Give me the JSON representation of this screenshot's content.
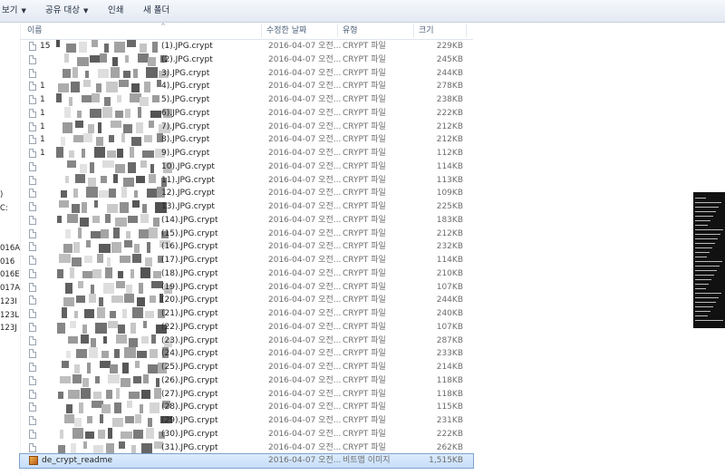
{
  "toolbar": {
    "view_label": "보기",
    "share_label": "공유 대상",
    "print_label": "인쇄",
    "new_folder_label": "새 폴더"
  },
  "nav_pane": {
    "items": [
      ")",
      "C:",
      "016A",
      "016",
      "016E",
      "017A",
      "123I",
      "123L",
      "123J"
    ]
  },
  "columns": {
    "name": "이름",
    "date": "수정한 날짜",
    "type": "유형",
    "size": "크기"
  },
  "files": [
    {
      "prefix": "15",
      "name": "(1).JPG.crypt",
      "date": "2016-04-07 오전...",
      "type": "CRYPT 파일",
      "size": "229KB"
    },
    {
      "prefix": "",
      "name": "(2).JPG.crypt",
      "date": "2016-04-07 오전...",
      "type": "CRYPT 파일",
      "size": "245KB"
    },
    {
      "prefix": "",
      "name": "3).JPG.crypt",
      "date": "2016-04-07 오전...",
      "type": "CRYPT 파일",
      "size": "244KB"
    },
    {
      "prefix": "1",
      "name": "4).JPG.crypt",
      "date": "2016-04-07 오전...",
      "type": "CRYPT 파일",
      "size": "278KB"
    },
    {
      "prefix": "1",
      "name": "5).JPG.crypt",
      "date": "2016-04-07 오전...",
      "type": "CRYPT 파일",
      "size": "238KB"
    },
    {
      "prefix": "1",
      "name": "6).JPG.crypt",
      "date": "2016-04-07 오전...",
      "type": "CRYPT 파일",
      "size": "222KB"
    },
    {
      "prefix": "1",
      "name": "7).JPG.crypt",
      "date": "2016-04-07 오전...",
      "type": "CRYPT 파일",
      "size": "212KB"
    },
    {
      "prefix": "1",
      "name": "8).JPG.crypt",
      "date": "2016-04-07 오전...",
      "type": "CRYPT 파일",
      "size": "212KB"
    },
    {
      "prefix": "1",
      "name": "9).JPG.crypt",
      "date": "2016-04-07 오전...",
      "type": "CRYPT 파일",
      "size": "112KB"
    },
    {
      "prefix": "",
      "name": "10).JPG.crypt",
      "date": "2016-04-07 오전...",
      "type": "CRYPT 파일",
      "size": "114KB"
    },
    {
      "prefix": "",
      "name": "11).JPG.crypt",
      "date": "2016-04-07 오전...",
      "type": "CRYPT 파일",
      "size": "113KB"
    },
    {
      "prefix": "",
      "name": "12).JPG.crypt",
      "date": "2016-04-07 오전...",
      "type": "CRYPT 파일",
      "size": "109KB"
    },
    {
      "prefix": "",
      "name": "13).JPG.crypt",
      "date": "2016-04-07 오전...",
      "type": "CRYPT 파일",
      "size": "225KB"
    },
    {
      "prefix": "",
      "name": "(14).JPG.crypt",
      "date": "2016-04-07 오전...",
      "type": "CRYPT 파일",
      "size": "183KB"
    },
    {
      "prefix": "",
      "name": "(15).JPG.crypt",
      "date": "2016-04-07 오전...",
      "type": "CRYPT 파일",
      "size": "212KB"
    },
    {
      "prefix": "",
      "name": "(16).JPG.crypt",
      "date": "2016-04-07 오전...",
      "type": "CRYPT 파일",
      "size": "232KB"
    },
    {
      "prefix": "",
      "name": "(17).JPG.crypt",
      "date": "2016-04-07 오전...",
      "type": "CRYPT 파일",
      "size": "114KB"
    },
    {
      "prefix": "",
      "name": "(18).JPG.crypt",
      "date": "2016-04-07 오전...",
      "type": "CRYPT 파일",
      "size": "210KB"
    },
    {
      "prefix": "",
      "name": "(19).JPG.crypt",
      "date": "2016-04-07 오전...",
      "type": "CRYPT 파일",
      "size": "107KB"
    },
    {
      "prefix": "",
      "name": "(20).JPG.crypt",
      "date": "2016-04-07 오전...",
      "type": "CRYPT 파일",
      "size": "244KB"
    },
    {
      "prefix": "",
      "name": "(21).JPG.crypt",
      "date": "2016-04-07 오전...",
      "type": "CRYPT 파일",
      "size": "240KB"
    },
    {
      "prefix": "",
      "name": "(22).JPG.crypt",
      "date": "2016-04-07 오전...",
      "type": "CRYPT 파일",
      "size": "107KB"
    },
    {
      "prefix": "",
      "name": "(23).JPG.crypt",
      "date": "2016-04-07 오전...",
      "type": "CRYPT 파일",
      "size": "287KB"
    },
    {
      "prefix": "",
      "name": "(24).JPG.crypt",
      "date": "2016-04-07 오전...",
      "type": "CRYPT 파일",
      "size": "233KB"
    },
    {
      "prefix": "",
      "name": "(25).JPG.crypt",
      "date": "2016-04-07 오전...",
      "type": "CRYPT 파일",
      "size": "214KB"
    },
    {
      "prefix": "",
      "name": "(26).JPG.crypt",
      "date": "2016-04-07 오전...",
      "type": "CRYPT 파일",
      "size": "118KB"
    },
    {
      "prefix": "",
      "name": "(27).JPG.crypt",
      "date": "2016-04-07 오전...",
      "type": "CRYPT 파일",
      "size": "118KB"
    },
    {
      "prefix": "",
      "name": "(28).JPG.crypt",
      "date": "2016-04-07 오전...",
      "type": "CRYPT 파일",
      "size": "115KB"
    },
    {
      "prefix": "",
      "name": "(29).JPG.crypt",
      "date": "2016-04-07 오전...",
      "type": "CRYPT 파일",
      "size": "231KB"
    },
    {
      "prefix": "",
      "name": "(30).JPG.crypt",
      "date": "2016-04-07 오전...",
      "type": "CRYPT 파일",
      "size": "222KB"
    },
    {
      "prefix": "",
      "name": "(31).JPG.crypt",
      "date": "2016-04-07 오전...",
      "type": "CRYPT 파일",
      "size": "262KB"
    },
    {
      "prefix": "",
      "name": "de_crypt_readme",
      "date": "2016-04-07 오전...",
      "type": "비트맵 이미지",
      "size": "1,515KB",
      "selected": true,
      "icon": "bitmap-image-icon"
    }
  ]
}
